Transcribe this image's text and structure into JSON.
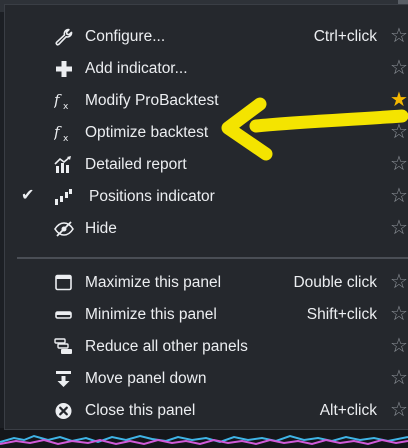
{
  "menu": {
    "items": [
      {
        "label": "Configure...",
        "shortcut": "Ctrl+click",
        "icon": "wrench-icon",
        "star": "☆",
        "favorite": false,
        "checked": false
      },
      {
        "label": "Add indicator...",
        "shortcut": "",
        "icon": "plus-icon",
        "star": "☆",
        "favorite": false,
        "checked": false
      },
      {
        "label": "Modify ProBacktest",
        "shortcut": "",
        "icon": "function-icon",
        "star": "★",
        "favorite": true,
        "checked": false
      },
      {
        "label": "Optimize backtest",
        "shortcut": "",
        "icon": "function-icon",
        "star": "☆",
        "favorite": false,
        "checked": false
      },
      {
        "label": "Detailed report",
        "shortcut": "",
        "icon": "report-chart-icon",
        "star": "☆",
        "favorite": false,
        "checked": false
      },
      {
        "label": "Positions indicator",
        "shortcut": "",
        "icon": "positions-bars-icon",
        "star": "☆",
        "favorite": false,
        "checked": true,
        "check": "✔"
      },
      {
        "label": "Hide",
        "shortcut": "",
        "icon": "eye-slash-icon",
        "star": "☆",
        "favorite": false,
        "checked": false
      },
      {
        "label": "Maximize this panel",
        "shortcut": "Double click",
        "icon": "window-icon",
        "star": "☆",
        "favorite": false,
        "checked": false
      },
      {
        "label": "Minimize this panel",
        "shortcut": "Shift+click",
        "icon": "minimize-icon",
        "star": "☆",
        "favorite": false,
        "checked": false
      },
      {
        "label": "Reduce all other panels",
        "shortcut": "",
        "icon": "stacked-panels-icon",
        "star": "☆",
        "favorite": false,
        "checked": false
      },
      {
        "label": "Move panel down",
        "shortcut": "",
        "icon": "move-down-icon",
        "star": "☆",
        "favorite": false,
        "checked": false
      },
      {
        "label": "Close this panel",
        "shortcut": "Alt+click",
        "icon": "close-circle-icon",
        "star": "☆",
        "favorite": false,
        "checked": false
      }
    ]
  },
  "annotation": {
    "color": "#f4e400",
    "shape": "yellow-arrow-icon"
  },
  "colors": {
    "menu_bg": "#25282d",
    "text": "#eceef1",
    "star_fav": "#f5b800",
    "star": "#8f949b"
  }
}
